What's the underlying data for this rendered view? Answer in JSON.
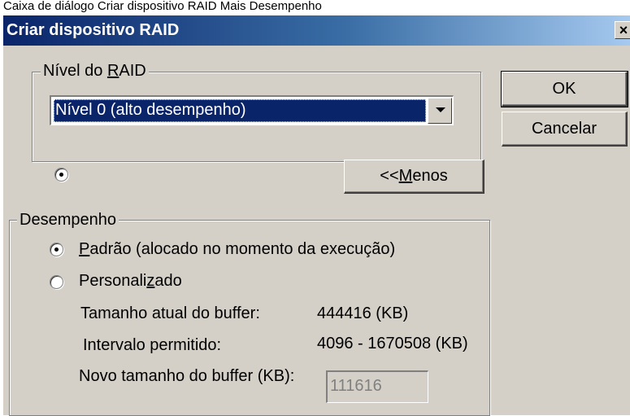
{
  "caption": "Caixa de diálogo Criar dispositivo RAID Mais Desempenho",
  "dialog": {
    "title": "Criar dispositivo RAID",
    "close_glyph": "×"
  },
  "raid_level": {
    "group_label_before": "Nível do ",
    "group_label_mnemonic": "R",
    "group_label_after": "AID",
    "selected_value": "Nível 0 (alto desempenho)"
  },
  "buttons": {
    "ok_label": "OK",
    "cancel_label": "Cancelar",
    "less_prefix": "<< ",
    "less_mnemonic": "M",
    "less_suffix": "enos"
  },
  "performance": {
    "group_label": "Desempenho",
    "default_option_mnemonic": "P",
    "default_option_rest": "adrão (alocado no momento da execução)",
    "default_selected": true,
    "custom_option_before": "Personali",
    "custom_option_mnemonic": "z",
    "custom_option_after": "ado",
    "current_buffer_label": "Tamanho atual do buffer:",
    "current_buffer_value": "444416 (KB)",
    "allowed_range_label": "Intervalo permitido:",
    "allowed_range_value": "4096 - 1670508 (KB)",
    "new_buffer_label": "Novo tamanho do buffer (KB):",
    "new_buffer_value": "111616"
  },
  "colors": {
    "titlebar_start": "#0a246a",
    "titlebar_end": "#a6caf0",
    "dialog_face": "#d4d0c8",
    "selection": "#0a246a"
  }
}
